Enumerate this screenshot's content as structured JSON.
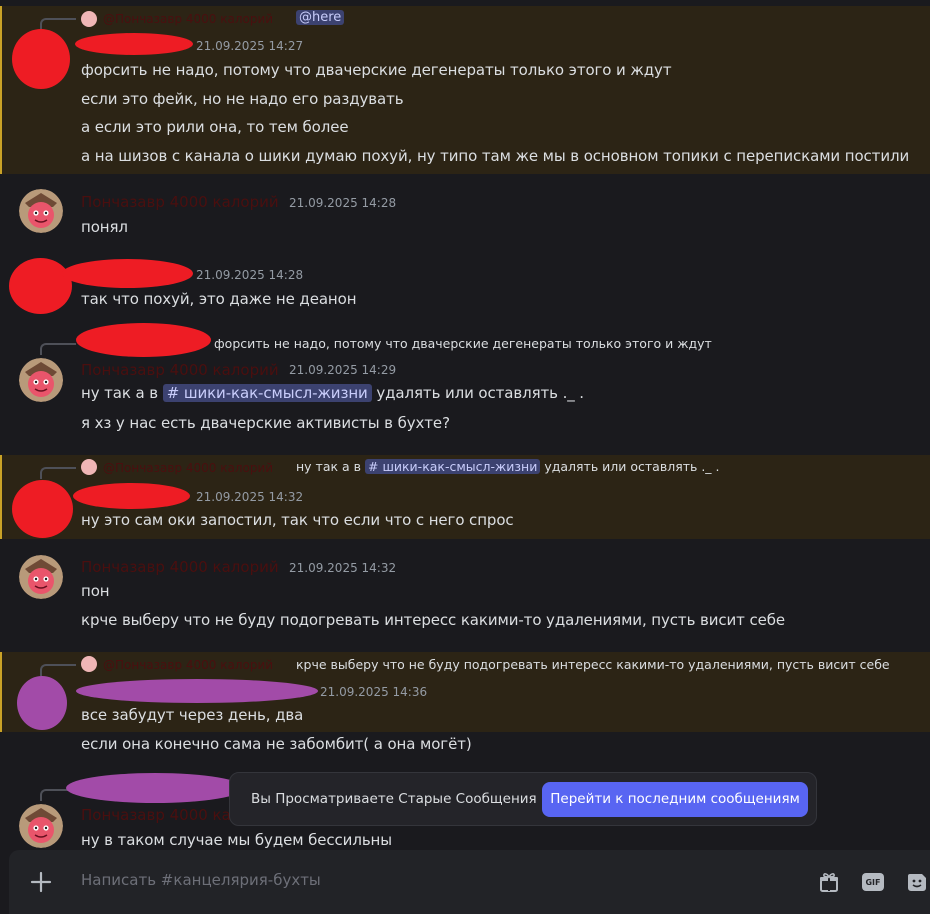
{
  "messages": {
    "m1": {
      "reply_name": "@Пончазавр 4000 калорий",
      "mention": "@here",
      "time": "21.09.2025 14:27",
      "lines": [
        "форсить не надо, потому что двачерские дегенераты только этого и ждут",
        "если это фейк, но не надо его раздувать",
        "а если это рили она, то тем более",
        "а на шизов с канала о шики думаю похуй, ну типо там же мы в основном топики с переписками постили"
      ]
    },
    "m2": {
      "user": "Пончазавр 4000 калорий",
      "time": "21.09.2025 14:28",
      "lines": [
        "понял"
      ]
    },
    "m3": {
      "time": "21.09.2025 14:28",
      "lines": [
        "так что похуй, это даже не деанон"
      ]
    },
    "m4": {
      "reply_text": "форсить не надо, потому что двачерские дегенераты только этого и ждут",
      "user": "Пончазавр 4000 калорий",
      "time": "21.09.2025 14:29",
      "line1_pre": "ну так а в",
      "channel": "# шики-как-смысл-жизни",
      "line1_post": "удалять или оставлять ._ .",
      "line2": "я хз у нас есть двачерские активисты в бухте?"
    },
    "m5": {
      "reply_name": "@Пончазавр 4000 калорий",
      "reply_pre": "ну так а в",
      "reply_channel": "# шики-как-смысл-жизни",
      "reply_post": "удалять или оставлять ._ .",
      "time": "21.09.2025 14:32",
      "lines": [
        "ну это сам оки запостил, так что если что с него спрос"
      ]
    },
    "m6": {
      "user": "Пончазавр 4000 калорий",
      "time": "21.09.2025 14:32",
      "lines": [
        "пон",
        "крче выберу что не буду подогревать интересс какими-то удалениями, пусть висит себе"
      ]
    },
    "m7": {
      "reply_name": "@Пончазавр 4000 калорий",
      "reply_text": "крче выберу что не буду подогревать интересс какими-то удалениями, пусть висит себе",
      "time": "21.09.2025 14:36",
      "lines": [
        "все забудут через день, два",
        "если она конечно сама не забомбит( а она могёт)"
      ]
    },
    "m8": {
      "user": "Пончазавр 4000 калорий",
      "lines": [
        "ну в таком случае мы будем бессильны"
      ]
    }
  },
  "banner": {
    "text": "Вы Просматриваете Старые Сообщения",
    "button": "Перейти к последним сообщениям"
  },
  "composer": {
    "placeholder": "Написать #канцелярия-бухты",
    "gif_label": "GIF"
  },
  "colors": {
    "accent": "#5865f2",
    "mention_bg": "#2c2415",
    "mention_bar": "#c9a227"
  }
}
